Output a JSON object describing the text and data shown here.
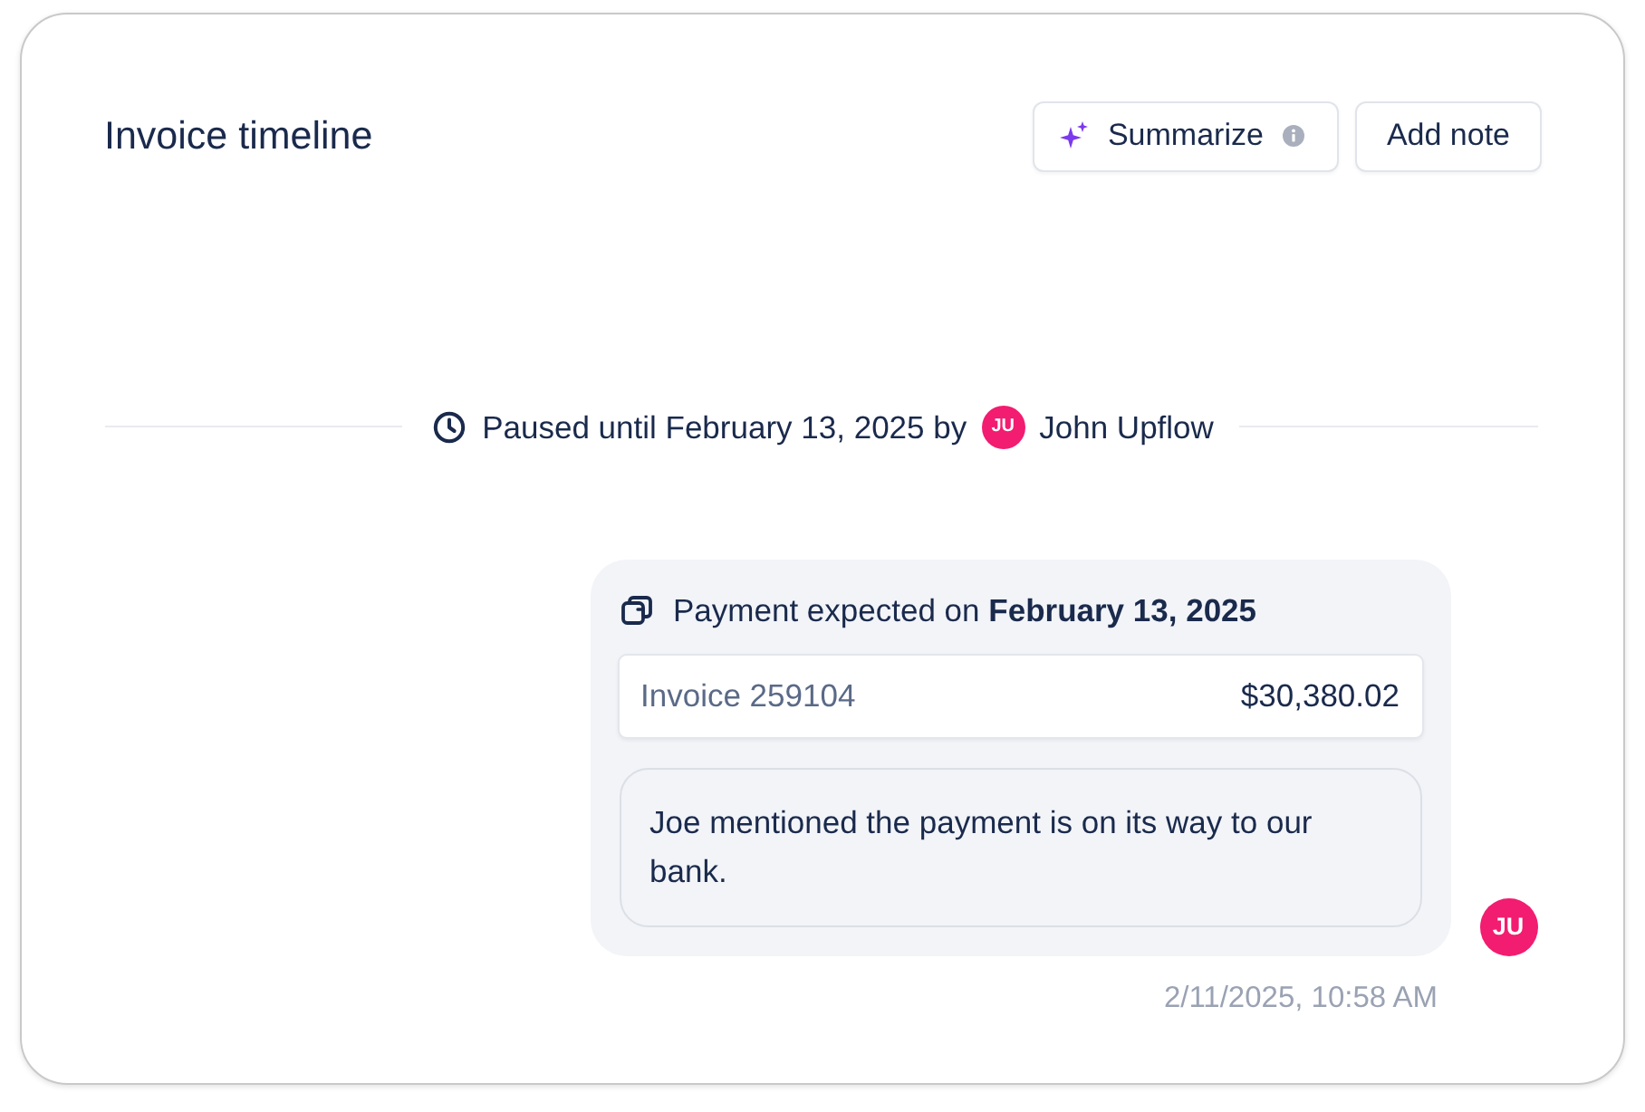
{
  "header": {
    "title": "Invoice timeline",
    "buttons": [
      {
        "kind": "summarize",
        "label": "Summarize"
      },
      {
        "kind": "note",
        "label": "Add note"
      }
    ]
  },
  "status_event": {
    "text": "Paused until February 13, 2025 by",
    "user": {
      "initials": "JU",
      "name": "John Upflow"
    }
  },
  "message": {
    "title": "Payment expected on **February 13, 2025**",
    "invoice": {
      "label": "Invoice 259104",
      "amount": "$30,380.02"
    },
    "note": "Joe mentioned the payment is on its way to our bank.",
    "author": {
      "initials": "JU"
    },
    "timestamp": "2/11/2025, 10:58 AM"
  }
}
